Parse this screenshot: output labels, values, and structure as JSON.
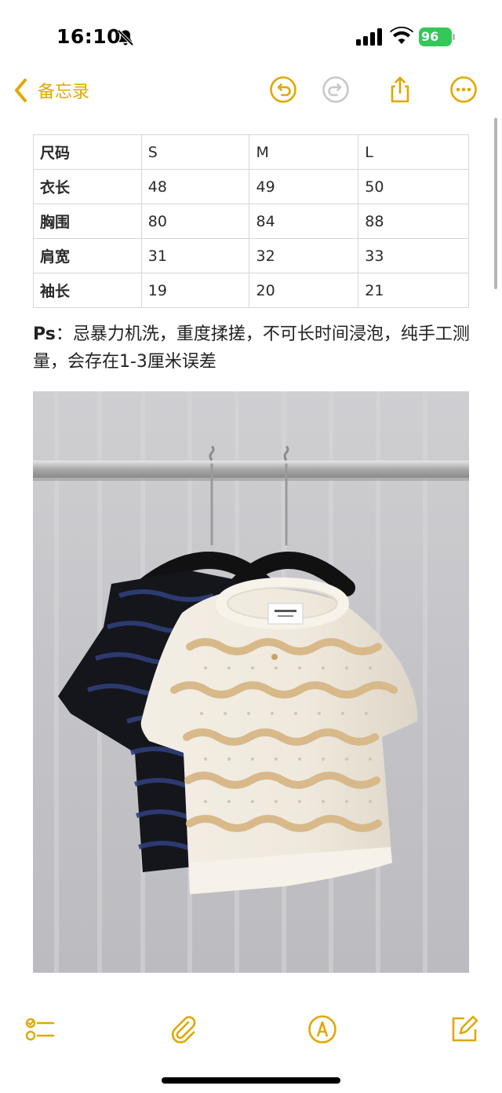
{
  "status_bar": {
    "time": "16:10",
    "battery_level": "96",
    "battery_color": "#34c759",
    "icons": [
      "bell-slash-icon",
      "cellular-signal-icon",
      "wifi-icon",
      "battery-charging-icon"
    ]
  },
  "nav": {
    "back_label": "备忘录",
    "accent_color": "#e0a800",
    "icons": [
      "chevron-left-icon",
      "undo-icon",
      "redo-icon",
      "share-icon",
      "more-icon"
    ]
  },
  "size_table": {
    "header": [
      "尺码",
      "S",
      "M",
      "L"
    ],
    "rows": [
      [
        "衣长",
        "48",
        "49",
        "50"
      ],
      [
        "胸围",
        "80",
        "84",
        "88"
      ],
      [
        "肩宽",
        "31",
        "32",
        "33"
      ],
      [
        "袖长",
        "19",
        "20",
        "21"
      ]
    ]
  },
  "note": {
    "prefix": "Ps",
    "text": "：忌暴力机洗，重度揉搓，不可长时间浸泡，纯手工测量，会存在1-3厘米误差"
  },
  "photo": {
    "icon": "product-photo-sweaters"
  },
  "toolbar": {
    "icons": [
      "checklist-icon",
      "paperclip-icon",
      "markup-pen-icon",
      "compose-icon"
    ]
  }
}
